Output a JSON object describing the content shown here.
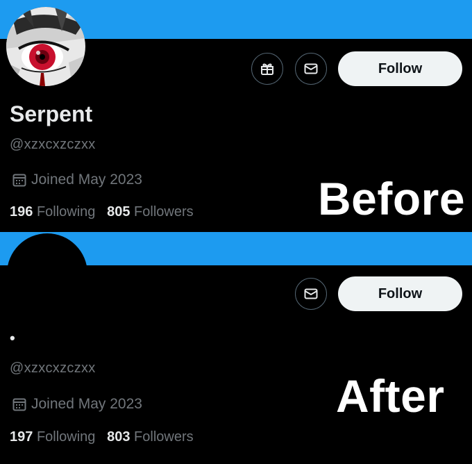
{
  "before": {
    "display_name": "Serpent",
    "handle": "@xzxcxzczxx",
    "joined": "Joined May 2023",
    "following_count": "196",
    "following_label": "Following",
    "followers_count": "805",
    "followers_label": "Followers",
    "follow_label": "Follow",
    "label": "Before"
  },
  "after": {
    "display_name": "•",
    "handle": "@xzxcxzczxx",
    "joined": "Joined May 2023",
    "following_count": "197",
    "following_label": "Following",
    "followers_count": "803",
    "followers_label": "Followers",
    "follow_label": "Follow",
    "label": "After"
  },
  "icons": [
    "gift-icon",
    "mail-icon",
    "calendar-icon"
  ],
  "colors": {
    "banner": "#1d9bf0",
    "background": "#000000",
    "follow_button": "#eff3f4",
    "muted_text": "#71767b"
  }
}
